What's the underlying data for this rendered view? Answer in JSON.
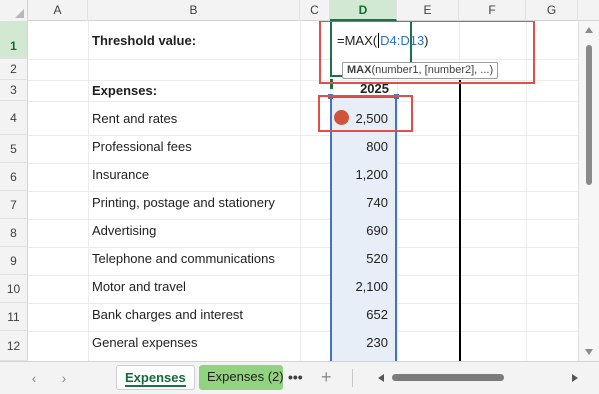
{
  "columns": [
    "A",
    "B",
    "C",
    "D",
    "E",
    "F",
    "G"
  ],
  "active_column": "D",
  "rows": [
    "1",
    "2",
    "3",
    "4",
    "5",
    "6",
    "7",
    "8",
    "9",
    "10",
    "11",
    "12"
  ],
  "cells": {
    "threshold_label": "Threshold value:",
    "expenses_header": "Expenses:",
    "year_header": "2025",
    "items": [
      {
        "label": "Rent and rates",
        "value": "2,500"
      },
      {
        "label": "Professional fees",
        "value": "800"
      },
      {
        "label": "Insurance",
        "value": "1,200"
      },
      {
        "label": "Printing, postage and stationery",
        "value": "740"
      },
      {
        "label": "Advertising",
        "value": "690"
      },
      {
        "label": "Telephone and communications",
        "value": "520"
      },
      {
        "label": "Motor and travel",
        "value": "2,100"
      },
      {
        "label": "Bank charges and interest",
        "value": "652"
      },
      {
        "label": "General expenses",
        "value": "230"
      }
    ]
  },
  "formula": {
    "function": "=MAX(",
    "range_ref": "D4:D13",
    "close": ")"
  },
  "tooltip": {
    "function_name": "MAX",
    "args": "(number1, [number2], ...)"
  },
  "sheets": {
    "active": "Expenses",
    "other": "Expenses (2)",
    "more": "•••",
    "add": "+"
  },
  "nav": {
    "prev": "‹",
    "next": "›"
  },
  "colors": {
    "accent_green": "#1e7145",
    "range_blue": "#4472c4",
    "highlight_red": "#e0504a",
    "tab_green": "#92d37f",
    "dot": "#d0543a"
  }
}
